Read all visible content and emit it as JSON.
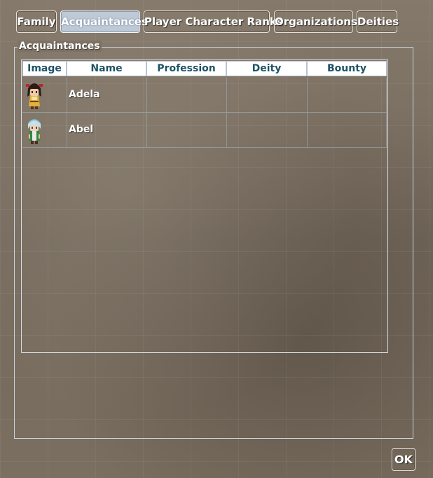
{
  "tabs": [
    {
      "label": "Family",
      "active": false
    },
    {
      "label": "Acquaintances",
      "active": true
    },
    {
      "label": "Player Character Ranks",
      "active": false
    },
    {
      "label": "Organizations",
      "active": false
    },
    {
      "label": "Deities",
      "active": false
    }
  ],
  "group": {
    "title": "Acquaintances"
  },
  "table": {
    "columns": [
      "Image",
      "Name",
      "Profession",
      "Deity",
      "Bounty"
    ],
    "rows": [
      {
        "image_icon": "female-character-sprite-icon",
        "name": "Adela",
        "profession": "",
        "deity": "",
        "bounty": ""
      },
      {
        "image_icon": "male-character-sprite-icon",
        "name": "Abel",
        "profession": "",
        "deity": "",
        "bounty": ""
      }
    ]
  },
  "footer": {
    "ok_label": "OK"
  }
}
